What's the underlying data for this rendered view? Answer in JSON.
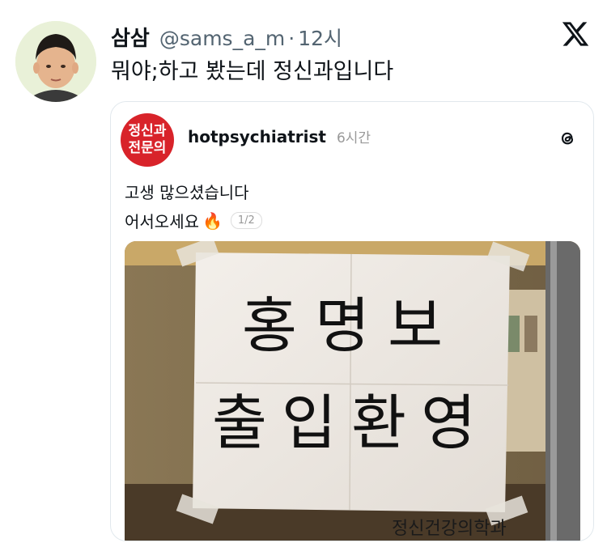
{
  "tweet": {
    "author_name": "삼삼",
    "handle": "@sams_a_m",
    "separator": "·",
    "time": "12시",
    "text": "뭐야;하고 봤는데 정신과입니다"
  },
  "embedded_post": {
    "logo_line1": "정신과",
    "logo_line2": "전문의",
    "account": "hotpsychiatrist",
    "time": "6시간",
    "line1": "고생 많으셨습니다",
    "line2": "어서오세요",
    "emoji": "🔥",
    "pager": "1/2",
    "photo": {
      "sign_line1": "홍명보",
      "sign_line2": "출입환영",
      "bottom_text": "정신건강의학과"
    }
  },
  "icons": {
    "platform_logo": "x-logo-icon",
    "threads": "threads-icon"
  },
  "colors": {
    "text": "#0f1419",
    "secondary": "#536471",
    "logo_red": "#d8232a",
    "avatar_bg": "#e9f1d8"
  }
}
